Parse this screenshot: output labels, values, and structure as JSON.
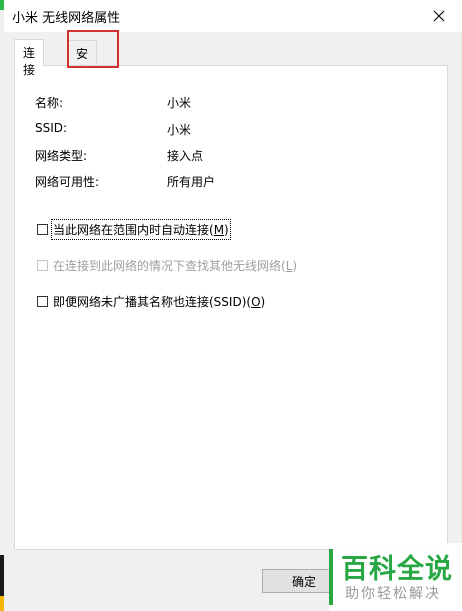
{
  "window": {
    "title": "小米 无线网络属性"
  },
  "tabs": [
    {
      "label": "连接",
      "active": true
    },
    {
      "label": "安全",
      "active": false
    }
  ],
  "properties": [
    {
      "label": "名称:",
      "value": "小米"
    },
    {
      "label": "SSID:",
      "value": "小米"
    },
    {
      "label": "网络类型:",
      "value": "接入点"
    },
    {
      "label": "网络可用性:",
      "value": "所有用户"
    }
  ],
  "options": [
    {
      "text": "当此网络在范围内时自动连接(",
      "key": "M",
      "end": ")",
      "checked": false,
      "enabled": true
    },
    {
      "text": "在连接到此网络的情况下查找其他无线网络(",
      "key": "L",
      "end": ")",
      "checked": false,
      "enabled": false
    },
    {
      "text": "即便网络未广播其名称也连接(SSID)(",
      "key": "O",
      "end": ")",
      "checked": false,
      "enabled": true
    }
  ],
  "buttons": {
    "ok_label": "确定"
  },
  "watermark": {
    "main": "百科全说",
    "sub": "助你轻松解决"
  },
  "colors": {
    "highlight": "#d32f2f",
    "watermark_green": "#27a844"
  }
}
